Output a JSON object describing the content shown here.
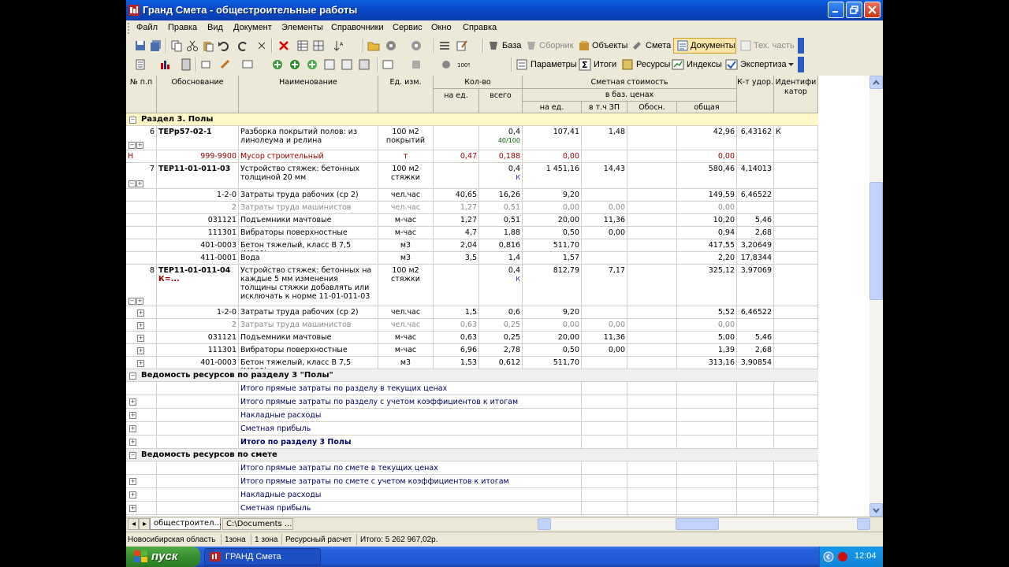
{
  "window": {
    "title": "Гранд Смета - общестроительные работы"
  },
  "menu": [
    "Файл",
    "Правка",
    "Вид",
    "Документ",
    "Элементы",
    "Справочники",
    "Сервис",
    "Окно",
    "Справка"
  ],
  "toolbar1": {
    "baza": "База",
    "sbornik": "Сборник",
    "objects": "Объекты",
    "smeta": "Смета",
    "documents": "Документы",
    "techpart": "Тех. часть"
  },
  "toolbar2": {
    "params": "Параметры",
    "itogi": "Итоги",
    "resursy": "Ресурсы",
    "indeksy": "Индексы",
    "expertiza": "Экспертиза"
  },
  "header": {
    "num": "№ п.п",
    "basis": "Обоснование",
    "name": "Наименование",
    "unit": "Ед. изм.",
    "qty": "Кол-во",
    "qty_unit": "на ед.",
    "qty_total": "всего",
    "cost": "Сметная стоимость",
    "base_prices": "в баз. ценах",
    "per_unit": "на ед.",
    "incl_zp": "в т.ч ЗП",
    "obosn": "Обосн.",
    "total": "общая",
    "coef": "К-т удор.",
    "ident": "Идентифи катор"
  },
  "rows": [
    {
      "type": "section",
      "label": "Раздел 3. Полы",
      "style": "yellow"
    },
    {
      "n": "6",
      "code": "ТЕРр57-02-1",
      "name": "Разборка покрытий полов: из линолеума и релина",
      "unit": "100 м2 покрытий",
      "qty_unit": "",
      "qty_total": "0,4",
      "qty_sub": "40/100",
      "price": "107,41",
      "zp": "1,48",
      "obosn": "",
      "total": "42,96",
      "coef": "6,43162",
      "ident": "К",
      "h": 31,
      "pm": "⊟⊞"
    },
    {
      "n": "Н",
      "code": "999-9900",
      "name": "Мусор строительный",
      "unit": "т",
      "qty_unit": "0,47",
      "qty_total": "0,188",
      "price": "0,00",
      "zp": "",
      "total": "0,00",
      "coef": "",
      "h": 16,
      "style": "red"
    },
    {
      "n": "7",
      "code": "ТЕР11-01-011-03",
      "name": "Устройство стяжек: бетонных толщиной 20 мм",
      "unit": "100 м2 стяжки",
      "qty_unit": "",
      "qty_total": "0,4",
      "qty_sub": "К",
      "price": "1 451,16",
      "zp": "14,43",
      "total": "580,46",
      "coef": "4,14013",
      "h": 33,
      "pm": "⊟⊞"
    },
    {
      "n": "",
      "code": "1-2-0",
      "name": "Затраты труда рабочих (ср 2)",
      "unit": "чел.час",
      "qty_unit": "40,65",
      "qty_total": "16,26",
      "price": "9,20",
      "zp": "",
      "total": "149,59",
      "coef": "6,46522",
      "h": 16
    },
    {
      "n": "",
      "code": "2",
      "name": "Затраты труда машинистов",
      "unit": "чел.час",
      "qty_unit": "1,27",
      "qty_total": "0,51",
      "price": "0,00",
      "zp": "0,00",
      "total": "0,00",
      "coef": "",
      "h": 16,
      "style": "gray"
    },
    {
      "n": "",
      "code": "031121",
      "name": "Подъемники мачтовые строитель...",
      "unit": "м-час",
      "qty_unit": "1,27",
      "qty_total": "0,51",
      "price": "20,00",
      "zp": "11,36",
      "total": "10,20",
      "coef": "5,46",
      "h": 16
    },
    {
      "n": "",
      "code": "111301",
      "name": "Вибраторы поверхностные",
      "unit": "м-час",
      "qty_unit": "4,7",
      "qty_total": "1,88",
      "price": "0,50",
      "zp": "0,00",
      "total": "0,94",
      "coef": "2,68",
      "h": 16
    },
    {
      "n": "",
      "code": "401-0003",
      "name": "Бетон тяжелый, класс В 7,5 (М100)",
      "unit": "м3",
      "qty_unit": "2,04",
      "qty_total": "0,816",
      "price": "511,70",
      "zp": "",
      "total": "417,55",
      "coef": "3,20649",
      "h": 16
    },
    {
      "n": "",
      "code": "411-0001",
      "name": "Вода",
      "unit": "м3",
      "qty_unit": "3,5",
      "qty_total": "1,4",
      "price": "1,57",
      "zp": "",
      "total": "2,20",
      "coef": "17,8344",
      "h": 16
    },
    {
      "n": "8",
      "code": "ТЕР11-01-011-04",
      "code2": "К=...",
      "name": "Устройство стяжек: бетонных на каждые 5 мм изменения толщины стяжки добавлять или исключать к норме 11-01-011-03",
      "unit": "100 м2 стяжки",
      "qty_unit": "",
      "qty_total": "0,4",
      "qty_sub": "К",
      "price": "812,79",
      "zp": "7,17",
      "total": "325,12",
      "coef": "3,97069",
      "h": 53,
      "pm": "⊟⊞"
    },
    {
      "n": "",
      "code": "1-2-0",
      "name": "Затраты труда рабочих (ср 2)",
      "unit": "чел.час",
      "qty_unit": "1,5",
      "qty_total": "0,6",
      "price": "9,20",
      "zp": "",
      "total": "5,52",
      "coef": "6,46522",
      "h": 16,
      "pm1": "⊞"
    },
    {
      "n": "",
      "code": "2",
      "name": "Затраты труда машинистов",
      "unit": "чел.час",
      "qty_unit": "0,63",
      "qty_total": "0,25",
      "price": "0,00",
      "zp": "0,00",
      "total": "0,00",
      "coef": "",
      "h": 16,
      "style": "gray",
      "pm1": "⊞"
    },
    {
      "n": "",
      "code": "031121",
      "name": "Подъемники мачтовые строитель...",
      "unit": "м-час",
      "qty_unit": "0,63",
      "qty_total": "0,25",
      "price": "20,00",
      "zp": "11,36",
      "total": "5,00",
      "coef": "5,46",
      "h": 16,
      "pm1": "⊞"
    },
    {
      "n": "",
      "code": "111301",
      "name": "Вибраторы поверхностные",
      "unit": "м-час",
      "qty_unit": "6,96",
      "qty_total": "2,78",
      "price": "0,50",
      "zp": "0,00",
      "total": "1,39",
      "coef": "2,68",
      "h": 16,
      "pm1": "⊞"
    },
    {
      "n": "",
      "code": "401-0003",
      "name": "Бетон тяжелый, класс В 7,5 (М100)",
      "unit": "м3",
      "qty_unit": "1,53",
      "qty_total": "0,612",
      "price": "511,70",
      "zp": "",
      "total": "313,16",
      "coef": "3,90854",
      "h": 16,
      "pm1": "⊞"
    },
    {
      "type": "section",
      "label": "Ведомость ресурсов по разделу 3 \"Полы\"",
      "style": "gray"
    },
    {
      "type": "total",
      "name": "Итого прямые затраты по разделу в текущих ценах",
      "pm1": ""
    },
    {
      "type": "total",
      "name": "Итого прямые затраты по разделу с учетом коэффициентов к итогам",
      "pm1": "⊞"
    },
    {
      "type": "total",
      "name": "Накладные расходы",
      "pm1": "⊞"
    },
    {
      "type": "total",
      "name": "Сметная прибыль",
      "pm1": "⊞"
    },
    {
      "type": "total",
      "name": "Итого по разделу 3 Полы",
      "pm1": "⊞",
      "bold": true
    },
    {
      "type": "section",
      "label": "Ведомость ресурсов по смете",
      "style": "gray"
    },
    {
      "type": "total",
      "name": "Итого прямые затраты по смете в текущих ценах",
      "pm1": ""
    },
    {
      "type": "total",
      "name": "Итого прямые затраты по смете с учетом коэффициентов к итогам",
      "pm1": "⊞"
    },
    {
      "type": "total",
      "name": "Накладные расходы",
      "pm1": "⊞"
    },
    {
      "type": "total",
      "name": "Сметная прибыль",
      "pm1": "⊞"
    }
  ],
  "tabs": {
    "tab1": "общестроител...",
    "tab2": "C:\\Documents ..."
  },
  "status": {
    "region": "Новосибирская область",
    "zone1": "1зона",
    "zone2": "1 зона",
    "calc": "Ресурсный расчет",
    "total": "Итого: 5 262 967,02р."
  },
  "taskbar": {
    "start": "пуск",
    "app": "ГРАНД Смета",
    "clock": "12:04"
  },
  "colors": {
    "titlebar": "#0a5fe0",
    "section_yellow": "#fff8c8",
    "taskbar": "#245ed9",
    "start": "#3a8f2f"
  }
}
